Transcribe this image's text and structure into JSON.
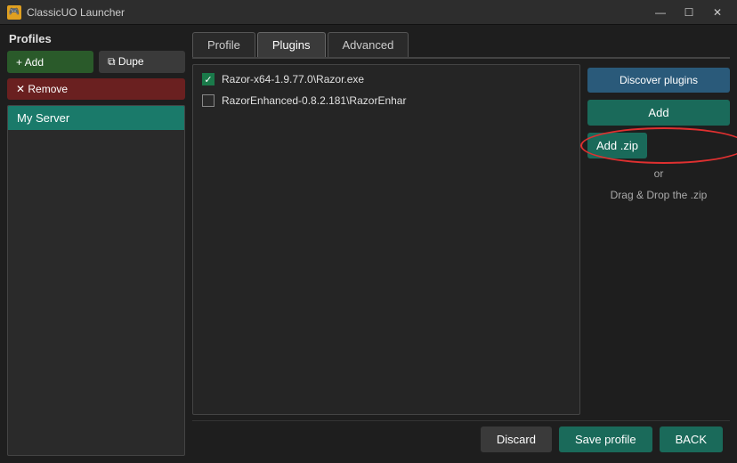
{
  "titlebar": {
    "icon": "🎮",
    "title": "ClassicUO Launcher",
    "minimize": "—",
    "maximize": "☐",
    "close": "✕"
  },
  "profiles": {
    "label": "Profiles",
    "add_btn": "+ Add",
    "dupe_btn": "⧉ Dupe",
    "remove_btn": "✕ Remove",
    "items": [
      {
        "name": "My Server",
        "selected": true
      }
    ]
  },
  "tabs": [
    {
      "label": "Profile",
      "active": false
    },
    {
      "label": "Plugins",
      "active": true
    },
    {
      "label": "Advanced",
      "active": false
    }
  ],
  "plugins": {
    "items": [
      {
        "name": "Razor-x64-1.9.77.0\\Razor.exe",
        "checked": true
      },
      {
        "name": "RazorEnhanced-0.8.2.181\\RazorEnhar",
        "checked": false
      }
    ]
  },
  "actions": {
    "discover_plugins": "Discover plugins",
    "add": "Add",
    "add_zip": "Add .zip",
    "or": "or",
    "drag_drop": "Drag & Drop the .zip"
  },
  "footer": {
    "discard": "Discard",
    "save_profile": "Save profile",
    "back": "BACK"
  }
}
